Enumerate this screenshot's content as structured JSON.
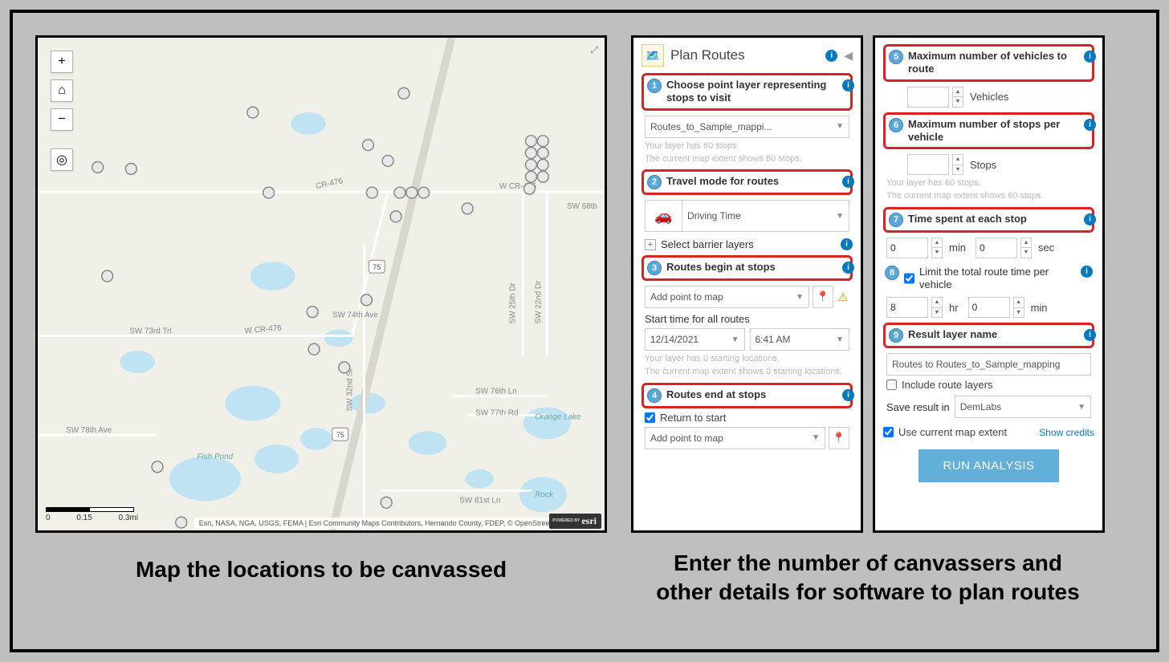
{
  "map": {
    "attribution": "Esri, NASA, NGA, USGS, FEMA | Esri Community Maps Contributors, Hernando County, FDEP, © OpenStree...",
    "esri_badge_prefix": "POWERED BY",
    "esri_badge": "esri",
    "scale_labels": [
      "0",
      "0.15",
      "0.3mi"
    ],
    "road_labels": [
      "W CR-476",
      "CR-476",
      "W CR-476",
      "SW 73rd Trl",
      "SW 74th Ave",
      "SW 78th Ave",
      "SW 32nd St",
      "SW 25th Dr",
      "SW 22nd Dr",
      "SW 68th",
      "SW 76th Ln",
      "SW 77th Rd",
      "SW 81st Ln"
    ],
    "lake_labels": [
      "Fish Pond",
      "Orange Lake",
      "Rock"
    ]
  },
  "captions": {
    "left": "Map the locations to be canvassed",
    "right_line1": "Enter the number of canvassers and",
    "right_line2": "other details for software to plan routes"
  },
  "panel": {
    "title": "Plan Routes",
    "collapse_icon": "◀",
    "steps": {
      "s1": {
        "num": "1",
        "label": "Choose point layer representing stops to visit",
        "dropdown": "Routes_to_Sample_mappi...",
        "hint1": "Your layer has 60 stops.",
        "hint2": "The current map extent shows 60 stops."
      },
      "s2": {
        "num": "2",
        "label": "Travel mode for routes",
        "mode": "Driving Time",
        "barrier_label": "Select barrier layers"
      },
      "s3": {
        "num": "3",
        "label": "Routes begin at stops",
        "dropdown": "Add point to map",
        "start_label": "Start time for all routes",
        "date": "12/14/2021",
        "time": "6:41 AM",
        "hint1": "Your layer has 0 starting locations.",
        "hint2": "The current map extent shows 0 starting locations."
      },
      "s4": {
        "num": "4",
        "label": "Routes end at stops",
        "return_label": "Return to start",
        "dropdown": "Add point to map"
      },
      "s5": {
        "num": "5",
        "label": "Maximum number of vehicles to route",
        "unit": "Vehicles"
      },
      "s6": {
        "num": "6",
        "label": "Maximum number of stops per vehicle",
        "unit": "Stops",
        "hint1": "Your layer has 60 stops.",
        "hint2": "The current map extent shows 60 stops."
      },
      "s7": {
        "num": "7",
        "label": "Time spent at each stop",
        "min_val": "0",
        "min_unit": "min",
        "sec_val": "0",
        "sec_unit": "sec"
      },
      "s8": {
        "num": "8",
        "label": "Limit the total route time per vehicle",
        "hr_val": "8",
        "hr_unit": "hr",
        "min_val": "0",
        "min_unit": "min"
      },
      "s9": {
        "num": "9",
        "label": "Result layer name",
        "value": "Routes to Routes_to_Sample_mapping",
        "include_label": "Include route layers",
        "save_label": "Save result in",
        "save_value": "DemLabs"
      }
    },
    "extent_label": "Use current map extent",
    "credits": "Show credits",
    "run": "RUN ANALYSIS"
  }
}
